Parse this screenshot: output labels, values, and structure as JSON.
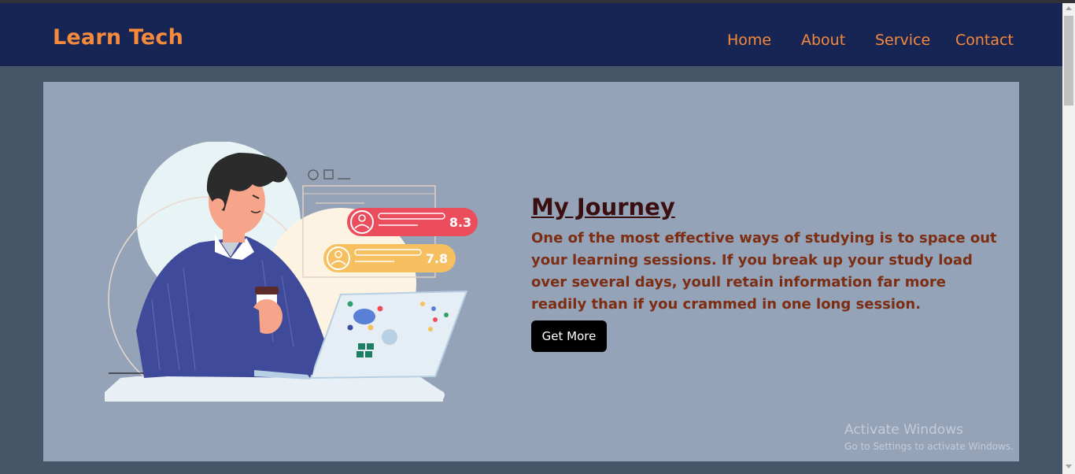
{
  "brand": {
    "name": "Learn Tech"
  },
  "nav": {
    "items": [
      "Home",
      "About",
      "Service",
      "Contact"
    ]
  },
  "hero": {
    "title": "My Journey",
    "description": "One of the most effective ways of studying is to space out your learning sessions. If you break up your study load over several days, youll retain information far more readily than if you crammed in one long session.",
    "button_label": "Get More",
    "scores": [
      "8.3",
      "7.8"
    ]
  },
  "watermark": {
    "line1": "Activate Windows",
    "line2": "Go to Settings to activate Windows."
  },
  "colors": {
    "nav_bg": "#172554",
    "accent": "#f58a3c",
    "page_bg": "#475569",
    "card_bg": "#94a3b8",
    "title": "#3b0f0f",
    "text": "#7c2d12",
    "button_bg": "#000000"
  }
}
